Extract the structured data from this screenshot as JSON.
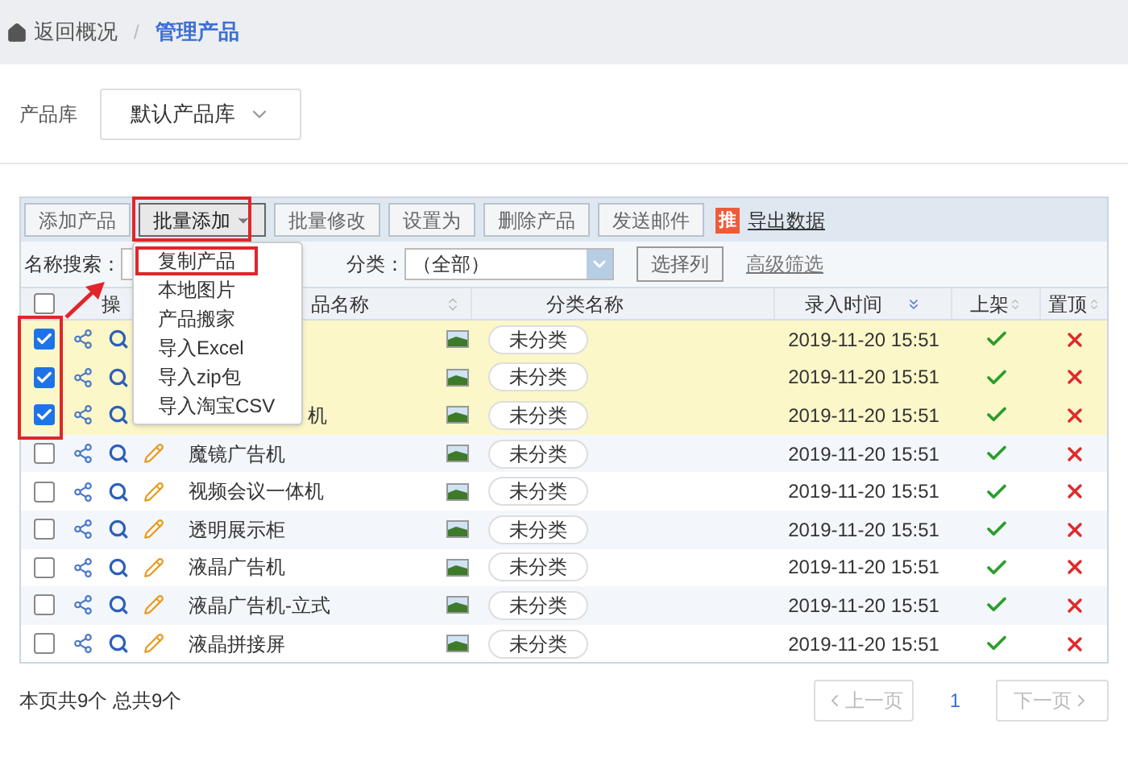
{
  "breadcrumb": {
    "back": "返回概况",
    "separator": "/",
    "current": "管理产品"
  },
  "library": {
    "label": "产品库",
    "value": "默认产品库"
  },
  "toolbar": {
    "buttons": [
      {
        "label": "添加产品",
        "kind": "plain"
      },
      {
        "label": "批量添加",
        "kind": "menu"
      },
      {
        "label": "批量修改",
        "kind": "plain"
      },
      {
        "label": "设置为",
        "kind": "plain"
      },
      {
        "label": "删除产品",
        "kind": "plain"
      },
      {
        "label": "发送邮件",
        "kind": "plain"
      }
    ],
    "badge": "推",
    "export_link": "导出数据"
  },
  "filters": {
    "name_label": "名称搜索：",
    "category_label": "分类：",
    "category_value": "（全部）",
    "columns_button": "选择列",
    "advanced_link": "高级筛选"
  },
  "menu": {
    "items": [
      {
        "label": "复制产品",
        "highlighted": true
      },
      {
        "label": "本地图片",
        "highlighted": false
      },
      {
        "label": "产品搬家",
        "highlighted": false
      },
      {
        "label": "导入Excel",
        "highlighted": false
      },
      {
        "label": "导入zip包",
        "highlighted": false
      },
      {
        "label": "导入淘宝CSV",
        "highlighted": false
      }
    ]
  },
  "table": {
    "header_checked": false,
    "columns": [
      "操",
      "品名称",
      "分类名称",
      "录入时间",
      "上架",
      "置顶"
    ],
    "rows": [
      {
        "checked": true,
        "covered": true,
        "category": "未分类",
        "time": "2019-11-20 15:51",
        "listed": true,
        "pinned": false
      },
      {
        "checked": true,
        "covered": true,
        "category": "未分类",
        "time": "2019-11-20 15:51",
        "listed": true,
        "pinned": false
      },
      {
        "checked": true,
        "covered": true,
        "name": "机",
        "category": "未分类",
        "time": "2019-11-20 15:51",
        "listed": true,
        "pinned": false
      },
      {
        "checked": false,
        "name": "魔镜广告机",
        "category": "未分类",
        "time": "2019-11-20 15:51",
        "listed": true,
        "pinned": false
      },
      {
        "checked": false,
        "name": "视频会议一体机",
        "category": "未分类",
        "time": "2019-11-20 15:51",
        "listed": true,
        "pinned": false
      },
      {
        "checked": false,
        "name": "透明展示柜",
        "category": "未分类",
        "time": "2019-11-20 15:51",
        "listed": true,
        "pinned": false
      },
      {
        "checked": false,
        "name": "液晶广告机",
        "category": "未分类",
        "time": "2019-11-20 15:51",
        "listed": true,
        "pinned": false
      },
      {
        "checked": false,
        "name": "液晶广告机-立式",
        "category": "未分类",
        "time": "2019-11-20 15:51",
        "listed": true,
        "pinned": false
      },
      {
        "checked": false,
        "name": "液晶拼接屏",
        "category": "未分类",
        "time": "2019-11-20 15:51",
        "listed": true,
        "pinned": false
      }
    ]
  },
  "footer": {
    "summary": "本页共9个 总共9个",
    "prev": "上一页",
    "page": "1",
    "next": "下一页"
  }
}
